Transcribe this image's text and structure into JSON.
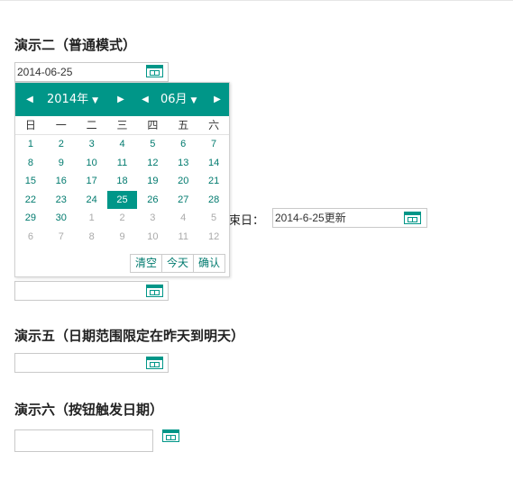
{
  "demo2": {
    "title": "演示二（普通模式）",
    "value": "2014-06-25"
  },
  "picker": {
    "year": "2014年",
    "month": "06月",
    "prev_year": "◀",
    "next_year": "▶",
    "prev_month": "◀",
    "next_month": "▶",
    "weekdays": [
      "日",
      "一",
      "二",
      "三",
      "四",
      "五",
      "六"
    ],
    "weeks": [
      [
        "1",
        "2",
        "3",
        "4",
        "5",
        "6",
        "7"
      ],
      [
        "8",
        "9",
        "10",
        "11",
        "12",
        "13",
        "14"
      ],
      [
        "15",
        "16",
        "17",
        "18",
        "19",
        "20",
        "21"
      ],
      [
        "22",
        "23",
        "24",
        "25",
        "26",
        "27",
        "28"
      ],
      [
        "29",
        "30",
        "1",
        "2",
        "3",
        "4",
        "5"
      ],
      [
        "6",
        "7",
        "8",
        "9",
        "10",
        "11",
        "12"
      ]
    ],
    "selected": "25",
    "clear": "清空",
    "today": "今天",
    "confirm": "确认"
  },
  "range": {
    "end_label": "结束日：",
    "end_value": "2014-6-25更新"
  },
  "demo5": {
    "title": "演示五（日期范围限定在昨天到明天）"
  },
  "demo6": {
    "title": "演示六（按钮触发日期）"
  }
}
